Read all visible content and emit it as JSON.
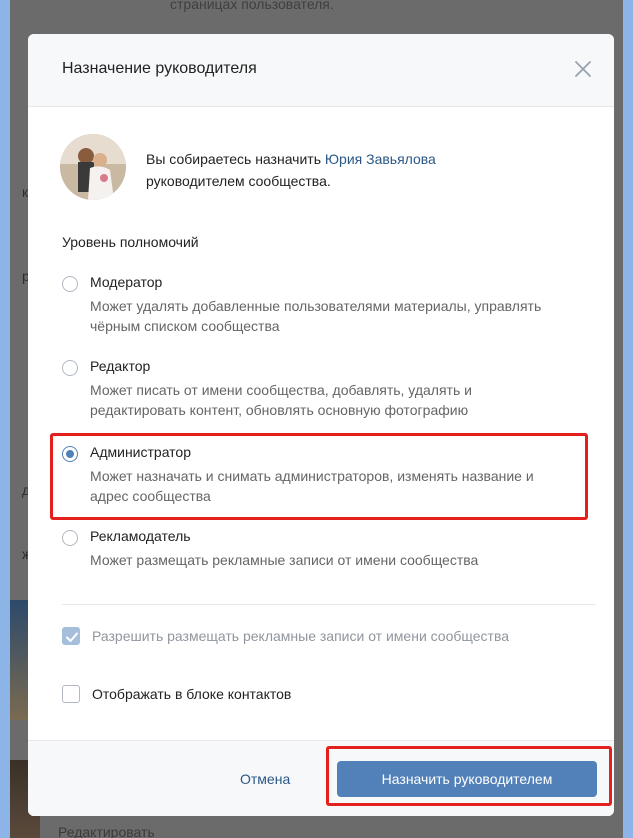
{
  "background": {
    "top_text": "страницах пользователя.",
    "bottom_text": "Редактировать",
    "fragments": [
      "ка",
      "ри",
      "ди",
      "ж"
    ]
  },
  "modal": {
    "title": "Назначение руководителя",
    "user": {
      "text_before": "Вы собираетесь назначить ",
      "name": "Юрия Завьялова",
      "text_after": "руководителем сообщества."
    },
    "permissions_title": "Уровень полномочий",
    "options": [
      {
        "label": "Модератор",
        "desc": "Может удалять добавленные пользователями материалы, управлять чёрным списком сообщества",
        "checked": false
      },
      {
        "label": "Редактор",
        "desc": "Может писать от имени сообщества, добавлять, удалять и редактировать контент, обновлять основную фотографию",
        "checked": false
      },
      {
        "label": "Администратор",
        "desc": "Может назначать и снимать администраторов, изменять название и адрес сообщества",
        "checked": true
      },
      {
        "label": "Рекламодатель",
        "desc": "Может размещать рекламные записи от имени сообщества",
        "checked": false
      }
    ],
    "checkboxes": [
      {
        "label": "Разрешить размещать рекламные записи от имени сообщества",
        "checked": true,
        "disabled": true
      },
      {
        "label": "Отображать в блоке контактов",
        "checked": false,
        "disabled": false
      }
    ],
    "cancel_label": "Отмена",
    "assign_label": "Назначить руководителем"
  },
  "colors": {
    "accent": "#5181b8",
    "link": "#2a5885",
    "highlight": "#e3201b"
  }
}
